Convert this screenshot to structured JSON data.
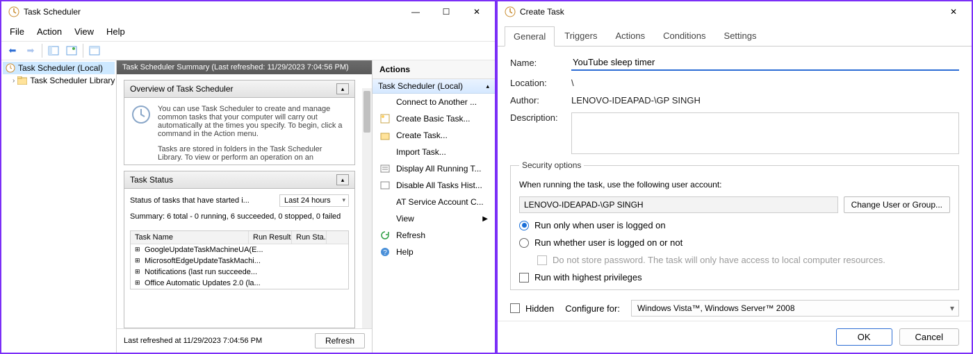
{
  "w1": {
    "title": "Task Scheduler",
    "menu": [
      "File",
      "Action",
      "View",
      "Help"
    ],
    "tree": {
      "root": "Task Scheduler (Local)",
      "child": "Task Scheduler Library"
    },
    "summary_header": "Task Scheduler Summary (Last refreshed: 11/29/2023 7:04:56 PM)",
    "overview": {
      "title": "Overview of Task Scheduler",
      "p1": "You can use Task Scheduler to create and manage common tasks that your computer will carry out automatically at the times you specify. To begin, click a command in the Action menu.",
      "p2": "Tasks are stored in folders in the Task Scheduler Library. To view or perform an operation on an"
    },
    "task_status": {
      "title": "Task Status",
      "label": "Status of tasks that have started i...",
      "combo": "Last 24 hours",
      "summary": "Summary: 6 total - 0 running, 6 succeeded, 0 stopped, 0 failed",
      "columns": [
        "Task Name",
        "Run Result",
        "Run Sta..."
      ],
      "rows": [
        "GoogleUpdateTaskMachineUA(E...",
        "MicrosoftEdgeUpdateTaskMachi...",
        "Notifications (last run succeede...",
        "Office Automatic Updates 2.0 (la..."
      ]
    },
    "footer": {
      "text": "Last refreshed at 11/29/2023 7:04:56 PM",
      "btn": "Refresh"
    },
    "actions": {
      "header": "Actions",
      "group": "Task Scheduler (Local)",
      "items": [
        "Connect to Another ...",
        "Create Basic Task...",
        "Create Task...",
        "Import Task...",
        "Display All Running T...",
        "Disable All Tasks Hist...",
        "AT Service Account C...",
        "View",
        "Refresh",
        "Help"
      ]
    }
  },
  "w2": {
    "title": "Create Task",
    "tabs": [
      "General",
      "Triggers",
      "Actions",
      "Conditions",
      "Settings"
    ],
    "name_label": "Name:",
    "name_value": "YouTube sleep timer",
    "location_label": "Location:",
    "location_value": "\\",
    "author_label": "Author:",
    "author_value": "LENOVO-IDEAPAD-\\GP SINGH",
    "desc_label": "Description:",
    "sec": {
      "title": "Security options",
      "when": "When running the task, use the following user account:",
      "account": "LENOVO-IDEAPAD-\\GP SINGH",
      "change": "Change User or Group...",
      "opt1": "Run only when user is logged on",
      "opt2": "Run whether user is logged on or not",
      "opt2sub": "Do not store password.  The task will only have access to local computer resources.",
      "highest": "Run with highest privileges"
    },
    "hidden": "Hidden",
    "configure_label": "Configure for:",
    "configure_value": "Windows Vista™, Windows Server™ 2008",
    "ok": "OK",
    "cancel": "Cancel"
  }
}
